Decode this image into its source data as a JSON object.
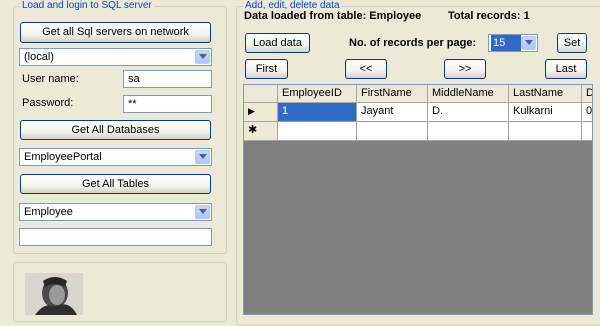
{
  "left_panel": {
    "group_title": "Load and login to SQL server",
    "get_servers_button": "Get all Sql servers  on network",
    "server_combo_value": "(local)",
    "username_label": "User name:",
    "username_value": "sa",
    "password_label": "Password:",
    "password_value": "**",
    "get_databases_button": "Get All Databases",
    "database_combo_value": "EmployeePortal",
    "get_tables_button": "Get All Tables",
    "table_combo_value": "Employee",
    "extra_field_value": ""
  },
  "right_panel": {
    "group_title": "Add, edit, delete data",
    "status_text": "Data loaded from table: Employee",
    "total_records_text": "Total records: 1",
    "load_data_button": "Load data",
    "records_per_page_label": "No. of records per page:",
    "records_per_page_value": "15",
    "set_button": "Set",
    "first_button": "First",
    "prev_button": "<<",
    "next_button": ">>",
    "last_button": "Last"
  },
  "grid": {
    "columns": [
      "EmployeeID",
      "FirstName",
      "MiddleName",
      "LastName",
      "D"
    ],
    "rows": [
      {
        "EmployeeID": "1",
        "FirstName": "Jayant",
        "MiddleName": "D.",
        "LastName": "Kulkarni",
        "D": "0"
      }
    ],
    "current_row_marker": "▶",
    "new_row_marker": "✱"
  },
  "colors": {
    "form_background": "#ece9d8",
    "group_title": "#0046d5",
    "selection": "#316ac5",
    "grid_background": "#808080"
  }
}
